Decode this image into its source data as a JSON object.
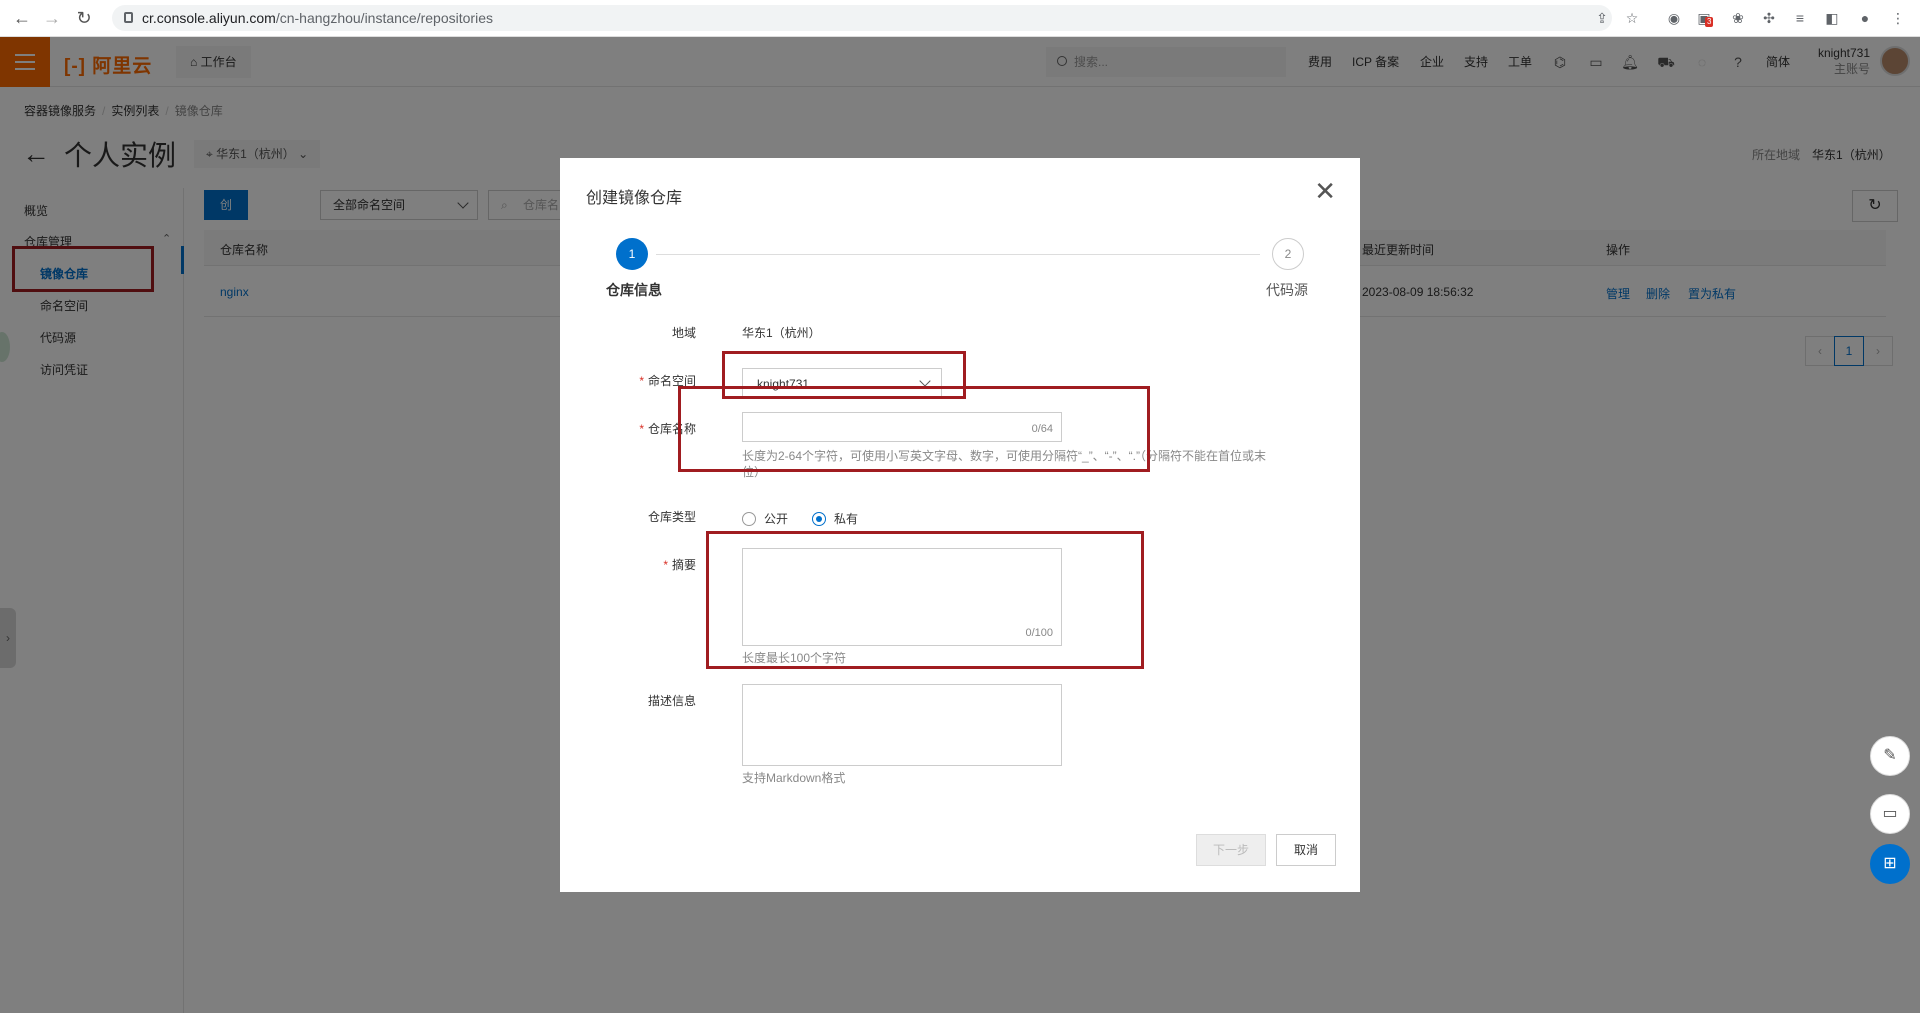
{
  "browser": {
    "url_host": "cr.console.aliyun.com",
    "url_path": "/cn-hangzhou/instance/repositories",
    "badge": "3"
  },
  "topbar": {
    "logo": "[-] 阿里云",
    "workbench": "工作台",
    "search_placeholder": "搜索...",
    "nav": [
      "费用",
      "ICP 备案",
      "企业",
      "支持",
      "工单"
    ],
    "lang": "简体",
    "user_name": "knight731",
    "user_role": "主账号"
  },
  "breadcrumb": [
    "容器镜像服务",
    "实例列表",
    "镜像仓库"
  ],
  "page": {
    "title": "个人实例",
    "region_select": "华东1（杭州）",
    "region_label": "所在地域",
    "region_value": "华东1（杭州）"
  },
  "sidebar": {
    "overview": "概览",
    "group": "仓库管理",
    "items": [
      "镜像仓库",
      "命名空间",
      "代码源",
      "访问凭证"
    ]
  },
  "toolbar": {
    "create_button": "创建镜像仓库",
    "namespace_filter": "全部命名空间",
    "search_placeholder": "仓库名"
  },
  "table": {
    "headers": {
      "name": "仓库名称",
      "updated": "最近更新时间",
      "actions": "操作"
    },
    "rows": [
      {
        "name": "nginx",
        "updated": "2023-08-09 18:56:32",
        "actions": [
          "管理",
          "删除",
          "置为私有"
        ]
      }
    ]
  },
  "pagination": {
    "current": "1"
  },
  "modal": {
    "title": "创建镜像仓库",
    "steps": [
      {
        "num": "1",
        "label": "仓库信息"
      },
      {
        "num": "2",
        "label": "代码源"
      }
    ],
    "fields": {
      "region_label": "地域",
      "region_value": "华东1（杭州）",
      "namespace_label": "命名空间",
      "namespace_value": "knight731",
      "repo_name_label": "仓库名称",
      "repo_name_counter": "0/64",
      "repo_name_hint": "长度为2-64个字符，可使用小写英文字母、数字，可使用分隔符“_”、“-”、“.”（分隔符不能在首位或末位）",
      "repo_type_label": "仓库类型",
      "repo_type_options": [
        "公开",
        "私有"
      ],
      "repo_type_selected": "私有",
      "summary_label": "摘要",
      "summary_counter": "0/100",
      "summary_hint": "长度最长100个字符",
      "desc_label": "描述信息",
      "desc_hint": "支持Markdown格式"
    },
    "next_button": "下一步",
    "cancel_button": "取消"
  },
  "colors": {
    "brand": "#ff6a00",
    "primary": "#0070cc",
    "highlight_box": "#a01c20",
    "required": "#d93026"
  }
}
